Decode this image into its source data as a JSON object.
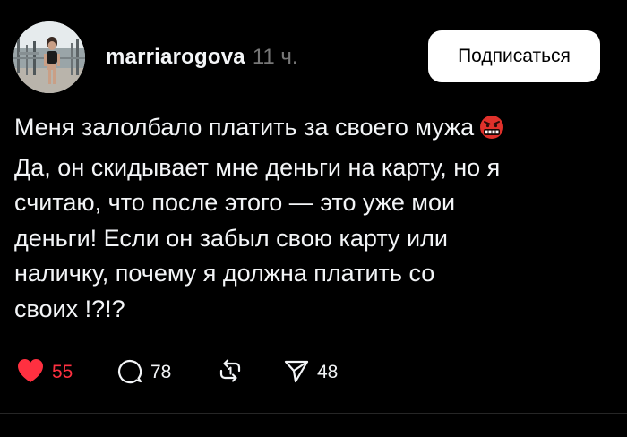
{
  "post": {
    "username": "marriarogova",
    "timestamp": "11 ч.",
    "follow_label": "Подписаться",
    "text_lines": [
      "Меня залолбало платить за своего мужа",
      "Да, он скидывает мне деньги на карту, но я",
      "считаю, что после этого — это уже мои",
      "деньги! Если он забыл свою карту или",
      "наличку, почему я должна платить со",
      "своих !?!?"
    ],
    "emoji": "angry-face-with-symbols-emoji"
  },
  "actions": {
    "likes": "55",
    "comments": "78",
    "reposts": "",
    "shares": "48"
  },
  "colors": {
    "background": "#000000",
    "text": "#f3f5f7",
    "secondary_text": "#777777",
    "like_red": "#ff3040",
    "button_bg": "#ffffff",
    "divider": "#262626"
  },
  "icons": {
    "like": "heart-icon",
    "comment": "comment-bubble-icon",
    "repost": "repost-arrows-icon",
    "share": "send-paper-plane-icon"
  }
}
